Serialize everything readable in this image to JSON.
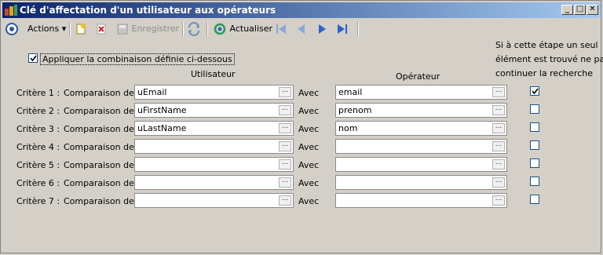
{
  "window": {
    "title": "Clé d'affectation d'un utilisateur aux opérateurs",
    "controls": [
      "minimize",
      "maximize",
      "close"
    ]
  },
  "toolbar": {
    "actions_label": "Actions",
    "save_label": "Enregistrer",
    "refresh_label": "Actualiser",
    "icons": [
      "actions-gear-icon",
      "new-document-icon",
      "delete-icon",
      "save-icon",
      "sync-icon",
      "refresh-icon",
      "first-icon",
      "previous-icon",
      "next-icon",
      "last-icon"
    ]
  },
  "form": {
    "apply_label": "Appliquer la combinaison définie ci-dessous",
    "apply_checked": true,
    "col_user": "Utilisateur",
    "col_operator": "Opérateur",
    "stop_note_line1": "Si à cette étape un seul",
    "stop_note_line2": "élément est trouvé ne pas",
    "stop_note_line3": "continuer la recherche",
    "compare_label": "Comparaison de :",
    "with_label": "Avec",
    "dots": "...",
    "rows": [
      {
        "criterion": "Critère 1 :",
        "user": "uEmail",
        "operator": "email",
        "stop": true
      },
      {
        "criterion": "Critère 2 :",
        "user": "uFirstName",
        "operator": "prenom",
        "stop": false
      },
      {
        "criterion": "Critère 3 :",
        "user": "uLastName",
        "operator": "nom",
        "stop": false
      },
      {
        "criterion": "Critère 4 :",
        "user": "",
        "operator": "",
        "stop": false
      },
      {
        "criterion": "Critère 5 :",
        "user": "",
        "operator": "",
        "stop": false
      },
      {
        "criterion": "Critère 6 :",
        "user": "",
        "operator": "",
        "stop": false
      },
      {
        "criterion": "Critère 7 :",
        "user": "",
        "operator": "",
        "stop": false
      }
    ]
  }
}
